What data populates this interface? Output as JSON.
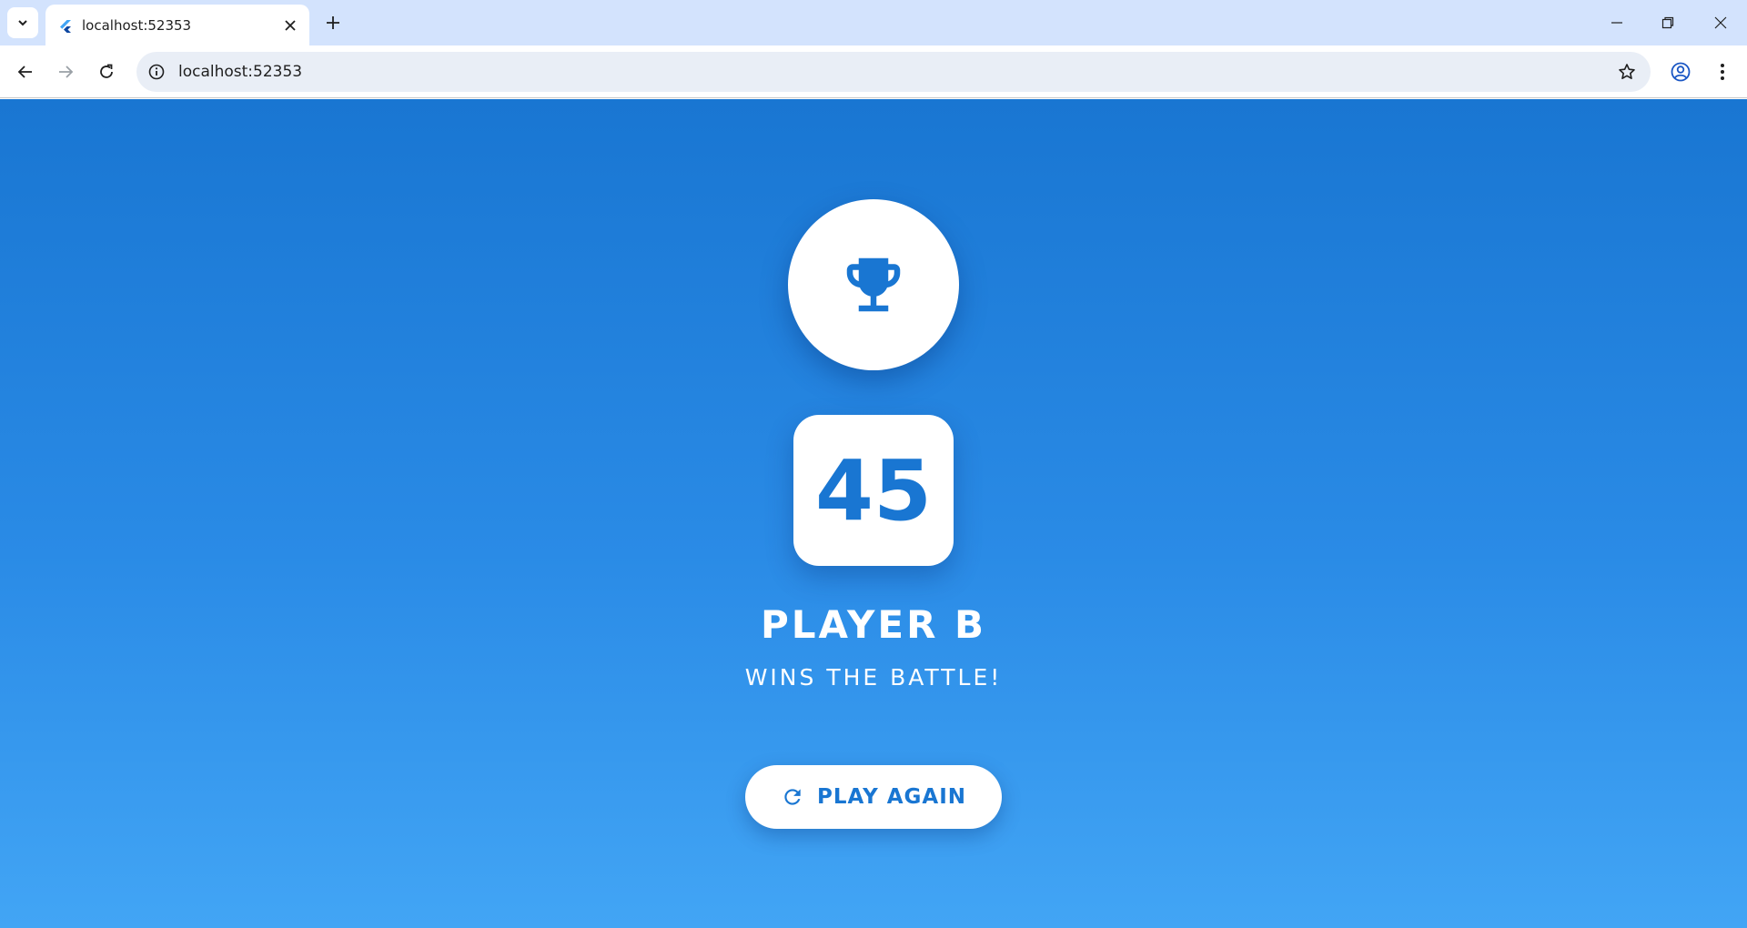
{
  "browser": {
    "tab": {
      "title": "localhost:52353",
      "favicon": "flutter-icon"
    },
    "address_bar": {
      "url": "localhost:52353"
    },
    "colors": {
      "tabstrip": "#d3e3fd",
      "omnibox": "#e9eef6"
    }
  },
  "game": {
    "score": "45",
    "winner": "PLAYER B",
    "subtitle": "WINS THE BATTLE!",
    "trophy_icon": "trophy-icon",
    "play_again": {
      "label": "PLAY AGAIN",
      "icon": "refresh-icon"
    }
  },
  "colors": {
    "accent": "#1976d2",
    "background_top": "#1976d2",
    "background_bottom": "#42a5f5"
  }
}
